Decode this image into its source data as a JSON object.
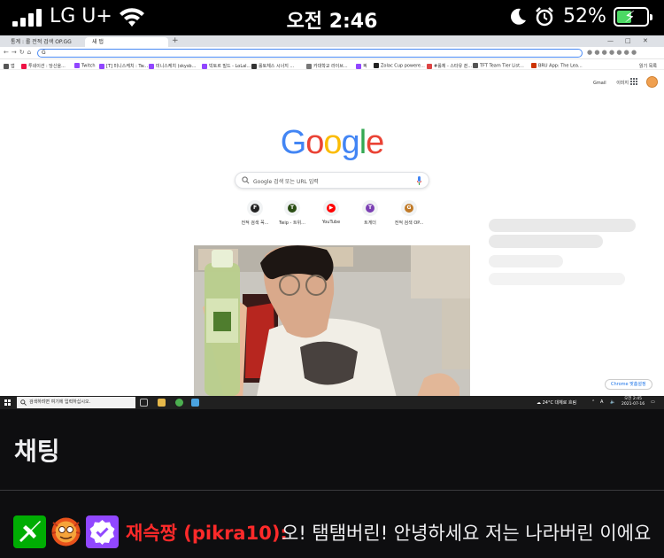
{
  "status_bar": {
    "carrier": "LG U+",
    "time": "오전 2:46",
    "battery_percent": "52%",
    "battery_level": 0.52,
    "icons": [
      "signal-icon",
      "wifi-icon",
      "moon-icon",
      "alarm-icon",
      "battery-charging-icon"
    ]
  },
  "browser": {
    "tabs": [
      "통계 : 롤 전적 검색 OP.GG",
      "새 탭"
    ],
    "new_tab": "+",
    "omnibox_value": "G",
    "bookmarks": [
      "앱",
      "투네이션 : 당신을...",
      "Twitch",
      "[T] 미니스케치 : Tw...",
      "미니스케치 (skysb...",
      "빅토르 빌드 - LoLal...",
      "롤토체스 시너지 ...",
      "카대학교 라이브...",
      "픽",
      "Zolac Cup powere...",
      "#롤체 - 스타유 쥔...",
      "TFT Team Tier List...",
      "BRU App: The Lea..."
    ],
    "reading_list": "읽기 목록"
  },
  "google": {
    "header_links": [
      "Gmail",
      "이미지"
    ],
    "logo_letters": [
      "G",
      "o",
      "o",
      "g",
      "l",
      "e"
    ],
    "search_placeholder": "Google 검색 또는 URL 입력",
    "shortcuts": [
      {
        "label": "전적 검색 꼭...",
        "letter": "F",
        "color": "#222222"
      },
      {
        "label": "Twip - 트위...",
        "letter": "T",
        "color": "#2a4d14"
      },
      {
        "label": "YouTube",
        "letter": "▶",
        "color": "#ff0000"
      },
      {
        "label": "트게더",
        "letter": "T",
        "color": "#7b3fb3"
      },
      {
        "label": "전적 검색 OP...",
        "letter": "G",
        "color": "#c07a28"
      }
    ],
    "customize_button": "Chrome 맞춤설정"
  },
  "taskbar": {
    "search_placeholder": "검색하려면 여기에 입력하십시오.",
    "weather": "24°C 대체로 흐림",
    "ime": "A",
    "time": "오전 2:45",
    "date": "2021-07-16"
  },
  "chat": {
    "title": "채팅",
    "message": {
      "badges": [
        "moderator-badge",
        "subscriber-badge",
        "verified-badge"
      ],
      "username": "재슥짱 (pikra10):",
      "text": "오! 탬탬버린! 안녕하세요 저는 나라버린 이에요",
      "username_color": "#ff2a2a"
    }
  }
}
